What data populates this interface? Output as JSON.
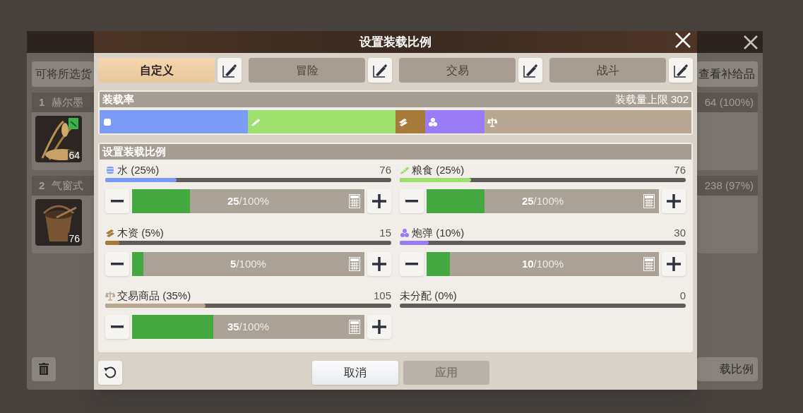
{
  "background_window": {
    "hint": "可将所选货",
    "view_supplies": "查看补给品",
    "ratio_button": "载比例",
    "cargo": [
      {
        "index": "1",
        "name": "赫尔墨",
        "count": "64",
        "load": "64 (100%)",
        "kind": "grain"
      },
      {
        "index": "2",
        "name": "气窗式",
        "count": "76",
        "load": "238 (97%)",
        "kind": "bucket"
      }
    ]
  },
  "dialog": {
    "title": "设置装载比例",
    "presets": [
      {
        "label": "自定义",
        "selected": true
      },
      {
        "label": "冒险",
        "selected": false
      },
      {
        "label": "交易",
        "selected": false
      },
      {
        "label": "战斗",
        "selected": false
      }
    ],
    "load": {
      "label": "装载率",
      "capacity": "装载量上限 302",
      "segments": [
        {
          "kind": "water",
          "color": "#7a9cf7"
        },
        {
          "kind": "food",
          "color": "#9de06d"
        },
        {
          "kind": "wood",
          "color": "#a77a3a"
        },
        {
          "kind": "ammo",
          "color": "#9a7cf8"
        },
        {
          "kind": "trade",
          "color": "#b8a791"
        }
      ]
    },
    "allocation": {
      "title": "设置装载比例",
      "items": [
        {
          "kind": "water",
          "label": "水 (25%)",
          "amount": "76",
          "color": "#7a9cf7",
          "meter": {
            "level": 0.25
          },
          "slider": {
            "level": 0.25,
            "value": "25",
            "unit": "/100%"
          }
        },
        {
          "kind": "food",
          "label": "粮食 (25%)",
          "amount": "76",
          "color": "#9de06d",
          "meter": {
            "level": 0.25
          },
          "slider": {
            "level": 0.25,
            "value": "25",
            "unit": "/100%"
          }
        },
        {
          "kind": "wood",
          "label": "木资 (5%)",
          "amount": "15",
          "color": "#a77a3a",
          "meter": {
            "level": 0.05
          },
          "slider": {
            "level": 0.05,
            "value": "5",
            "unit": "/100%"
          }
        },
        {
          "kind": "ammo",
          "label": "炮弹 (10%)",
          "amount": "30",
          "color": "#9a7cf8",
          "meter": {
            "level": 0.1
          },
          "slider": {
            "level": 0.1,
            "value": "10",
            "unit": "/100%"
          }
        },
        {
          "kind": "trade",
          "label": "交易商品 (35%)",
          "amount": "105",
          "color": "#b8a791",
          "meter": {
            "level": 0.35
          },
          "slider": {
            "level": 0.35,
            "value": "35",
            "unit": "/100%"
          }
        },
        {
          "kind": "unallocated",
          "label": "未分配 (0%)",
          "amount": "0",
          "color": "#5f5b58"
        }
      ]
    },
    "buttons": [
      {
        "label": "取消",
        "disabled": false
      },
      {
        "label": "应用",
        "disabled": true
      }
    ]
  }
}
